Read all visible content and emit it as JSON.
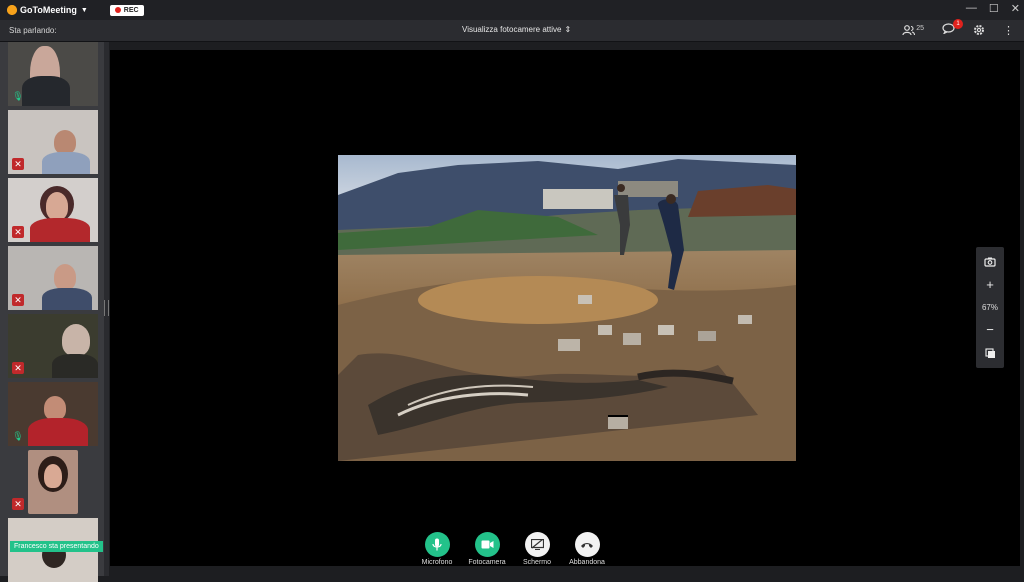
{
  "app": {
    "brand": "GoToMeeting",
    "rec_label": "REC"
  },
  "window_controls": {
    "minimize": "—",
    "maximize": "☐",
    "close": "✕"
  },
  "toolbar": {
    "speaking_label": "Sta parlando:",
    "camera_select": "Visualizza fotocamere attive",
    "attendee_count": "25",
    "chat_badge": "1"
  },
  "participants": [
    {
      "mic": "on"
    },
    {
      "mic": "off"
    },
    {
      "mic": "off"
    },
    {
      "mic": "off"
    },
    {
      "mic": "off"
    },
    {
      "mic": "on"
    },
    {
      "mic": "off"
    },
    {
      "mic": "off"
    }
  ],
  "presenter_banner": "Francesco sta presentando",
  "zoom": {
    "level": "67%"
  },
  "controls": {
    "mic_label": "Microfono",
    "camera_label": "Fotocamera",
    "screen_label": "Schermo",
    "leave_label": "Abbandona"
  },
  "colors": {
    "accent_green": "#23c28a",
    "rec_red": "#e0221d",
    "brand_orange": "#f7a21b"
  }
}
